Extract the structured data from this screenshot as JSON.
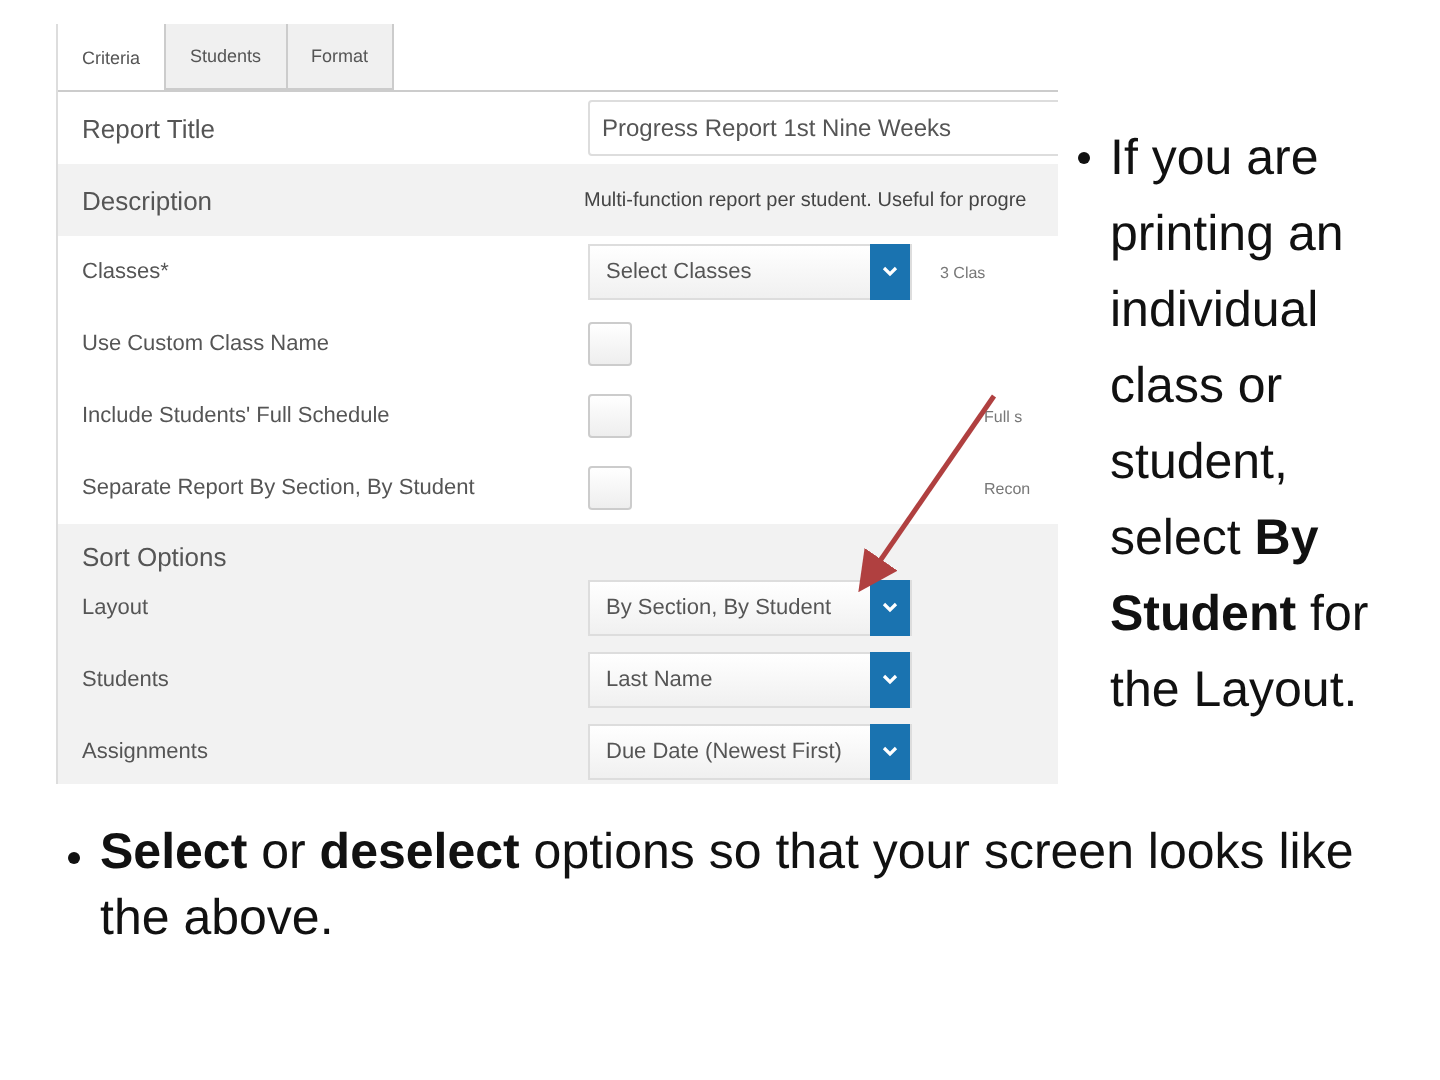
{
  "screenshot": {
    "tabs": [
      {
        "label": "Criteria",
        "selected": true
      },
      {
        "label": "Students",
        "selected": false
      },
      {
        "label": "Format",
        "selected": false
      }
    ],
    "rows": [
      {
        "kind": "text",
        "label": "Report Title",
        "value": "Progress Report 1st Nine Weeks"
      },
      {
        "kind": "description",
        "label": "Description",
        "value": "Multi-function report per student. Useful for progre"
      },
      {
        "kind": "select",
        "label": "Classes*",
        "value": "Select Classes",
        "note": "3 Clas"
      },
      {
        "kind": "checkbox",
        "label": "Use Custom Class Name",
        "checked": false
      },
      {
        "kind": "checkbox",
        "label": "Include Students' Full Schedule",
        "checked": false,
        "note": "Full s"
      },
      {
        "kind": "checkbox",
        "label": "Separate Report By Section, By Student",
        "checked": false,
        "note": "Recon"
      }
    ],
    "sort_options": {
      "heading": "Sort Options",
      "rows": [
        {
          "label": "Layout",
          "value": "By Section, By Student"
        },
        {
          "label": "Students",
          "value": "Last Name"
        },
        {
          "label": "Assignments",
          "value": "Due Date (Newest First)"
        }
      ]
    }
  },
  "bullets": [
    "If you are printing an individual class or student, select **By Student** for the Layout.",
    "**Select** or **deselect** options so that your screen looks like the above."
  ]
}
